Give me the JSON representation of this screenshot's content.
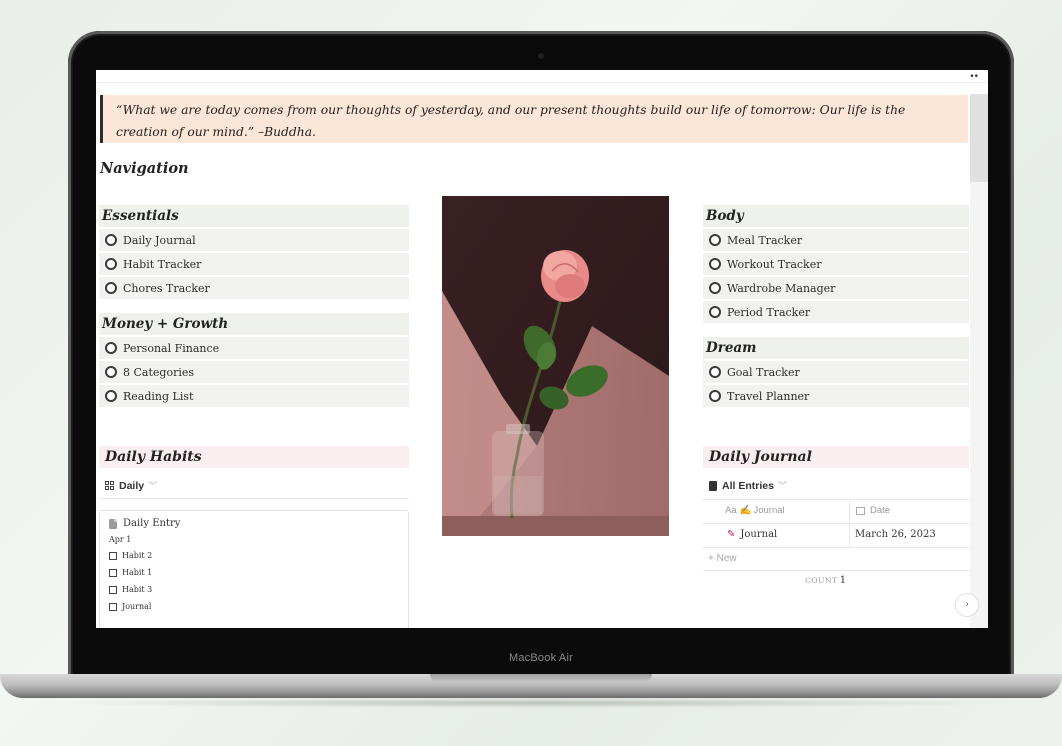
{
  "device": {
    "label": "MacBook Air"
  },
  "window": {
    "more_icon": "more-dots-icon"
  },
  "quote": {
    "text": "“What we are today comes from our thoughts of yesterday, and our present thoughts build our life of tomorrow: Our life is the creation of our mind.” –Buddha."
  },
  "navigation": {
    "title": "Navigation",
    "essentials": {
      "title": "Essentials",
      "items": [
        "Daily Journal",
        "Habit Tracker",
        "Chores Tracker"
      ]
    },
    "money": {
      "title": "Money + Growth",
      "items": [
        "Personal Finance",
        "8 Categories",
        "Reading List"
      ]
    },
    "body": {
      "title": "Body",
      "items": [
        "Meal Tracker",
        "Workout Tracker",
        "Wardrobe Manager",
        "Period Tracker"
      ]
    },
    "dream": {
      "title": "Dream",
      "items": [
        "Goal Tracker",
        "Travel Planner"
      ]
    }
  },
  "image": {
    "subject": "pink-rose-in-glass-vase"
  },
  "daily_habits": {
    "title": "Daily Habits",
    "view": "Daily",
    "card": {
      "title": "Daily Entry",
      "date": "Apr 1",
      "items": [
        "Habit 2",
        "Habit 1",
        "Habit 3",
        "Journal"
      ]
    }
  },
  "daily_journal": {
    "title": "Daily Journal",
    "view": "All Entries",
    "columns": {
      "text_prefix": "Aa",
      "name": "Journal",
      "date": "Date"
    },
    "rows": [
      {
        "name": "Journal",
        "date": "March 26, 2023"
      }
    ],
    "new_label": "New",
    "count_label": "COUNT",
    "count_value": "1"
  },
  "colors": {
    "quote_bg": "#fbe6d8",
    "section_bg": "#eef1ec",
    "pink_header_bg": "#fbeef0"
  }
}
